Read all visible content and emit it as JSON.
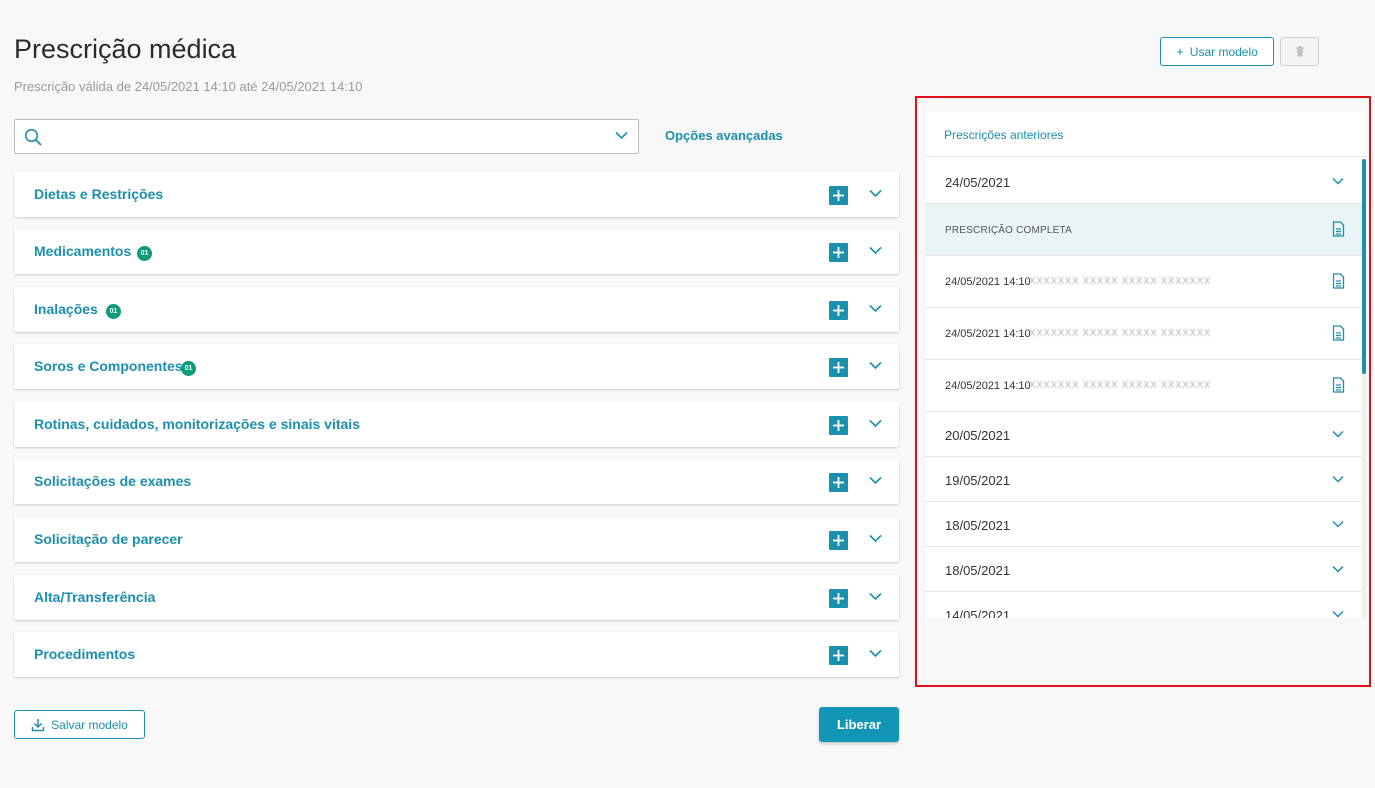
{
  "header": {
    "title": "Prescrição médica",
    "subtitle": "Prescrição válida de 24/05/2021 14:10 até 24/05/2021 14:10"
  },
  "toolbar": {
    "usar_modelo_label": "Usar modelo"
  },
  "search": {
    "value": "",
    "placeholder": "",
    "advanced_options_label": "Opções avançadas"
  },
  "sections": [
    {
      "label": "Dietas e Restrições",
      "badge": ""
    },
    {
      "label": "Medicamentos",
      "badge": "01"
    },
    {
      "label": "Inalações",
      "badge": "01"
    },
    {
      "label": "Soros e Componentes",
      "badge": "01"
    },
    {
      "label": "Rotinas, cuidados, monitorizações e sinais vitais",
      "badge": ""
    },
    {
      "label": "Solicitações de exames",
      "badge": ""
    },
    {
      "label": "Solicitação de parecer",
      "badge": ""
    },
    {
      "label": "Alta/Transferência",
      "badge": ""
    },
    {
      "label": "Procedimentos",
      "badge": ""
    }
  ],
  "footer": {
    "salvar_modelo_label": "Salvar modelo",
    "liberar_label": "Liberar"
  },
  "previous_prescriptions": {
    "title": "Prescrições anteriores",
    "expanded_date": "24/05/2021",
    "complete_label": "PRESCRIÇÃO COMPLETA",
    "entries": [
      {
        "time": "24/05/2021 14:10",
        "name": "XXXXXXX XXXXX XXXXX XXXXXXX"
      },
      {
        "time": "24/05/2021 14:10",
        "name": "XXXXXXX XXXXX XXXXX XXXXXXX"
      },
      {
        "time": "24/05/2021 14:10",
        "name": "XXXXXXX XXXXX XXXXX XXXXXXX"
      }
    ],
    "collapsed_dates": [
      "20/05/2021",
      "19/05/2021",
      "18/05/2021",
      "18/05/2021",
      "14/05/2021"
    ]
  },
  "colors": {
    "accent": "#1b8fae",
    "badge": "#0e9b79",
    "highlight": "#e0101a",
    "liberar_bg": "#1396b6"
  }
}
